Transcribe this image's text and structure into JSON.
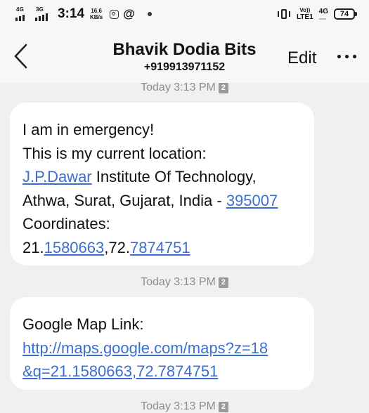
{
  "status_bar": {
    "sim1_label": "4G",
    "sim2_label": "3G",
    "time": "3:14",
    "speed_value": "16.6",
    "speed_unit": "KB/s",
    "at_symbol": "@",
    "volte_top": "Vo))",
    "volte_bottom": "LTE1",
    "net_right": "4G",
    "battery": "74",
    "icons": [
      "signal-icon",
      "instagram-icon",
      "at-icon",
      "notification-dot-icon",
      "vibrate-icon",
      "volte-icon",
      "battery-icon"
    ]
  },
  "header": {
    "contact_name": "Bhavik Dodia Bits",
    "contact_number": "+919913971152",
    "edit_label": "Edit",
    "back_icon": "chevron-left-icon",
    "more_icon": "more-dots-icon"
  },
  "messages": [
    {
      "timestamp": "Today 3:13 PM",
      "sim": "2"
    },
    {
      "timestamp": "Today 3:13 PM",
      "sim": "2",
      "line1": "I am in emergency!",
      "line2": "This is my current location:",
      "line3_link": "J.P.Dawar",
      "line3_rest": " Institute Of Technology,",
      "line4_text": "Athwa, Surat, Gujarat, India - ",
      "line4_link": "395007",
      "line5": "Coordinates:",
      "line6_a": "21.",
      "line6_link1": "1580663",
      "line6_b": ",72.",
      "line6_link2": "7874751"
    },
    {
      "timestamp": "Today 3:13 PM",
      "sim": "2",
      "line1": "Google Map Link:",
      "link_line1": "http://maps.google.com/maps?z=18",
      "link_line2": "&q=21.1580663,72.7874751"
    }
  ],
  "colors": {
    "background": "#f0f0f0",
    "bubble": "#ffffff",
    "link": "#3a6fd1",
    "timestamp": "#8e8e8e",
    "header": "#f7f7f7"
  }
}
